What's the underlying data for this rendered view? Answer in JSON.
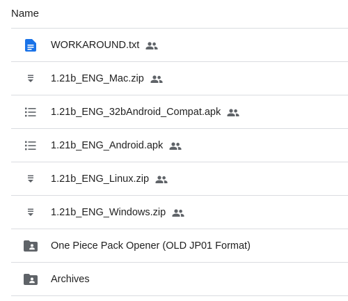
{
  "header": {
    "name_label": "Name"
  },
  "colors": {
    "doc_blue": "#1a73e8",
    "icon_gray": "#5f6368",
    "divider": "#dadce0",
    "text": "#1f1f1f"
  },
  "files": [
    {
      "name": "WORKAROUND.txt",
      "icon": "google-doc-icon",
      "shared": true
    },
    {
      "name": "1.21b_ENG_Mac.zip",
      "icon": "zip-file-icon",
      "shared": true
    },
    {
      "name": "1.21b_ENG_32bAndroid_Compat.apk",
      "icon": "list-file-icon",
      "shared": true
    },
    {
      "name": "1.21b_ENG_Android.apk",
      "icon": "list-file-icon",
      "shared": true
    },
    {
      "name": "1.21b_ENG_Linux.zip",
      "icon": "zip-file-icon",
      "shared": true
    },
    {
      "name": "1.21b_ENG_Windows.zip",
      "icon": "zip-file-icon",
      "shared": true
    },
    {
      "name": "One Piece Pack Opener (OLD JP01 Format)",
      "icon": "shared-folder-icon",
      "shared": false
    },
    {
      "name": "Archives",
      "icon": "shared-folder-icon",
      "shared": false
    }
  ]
}
